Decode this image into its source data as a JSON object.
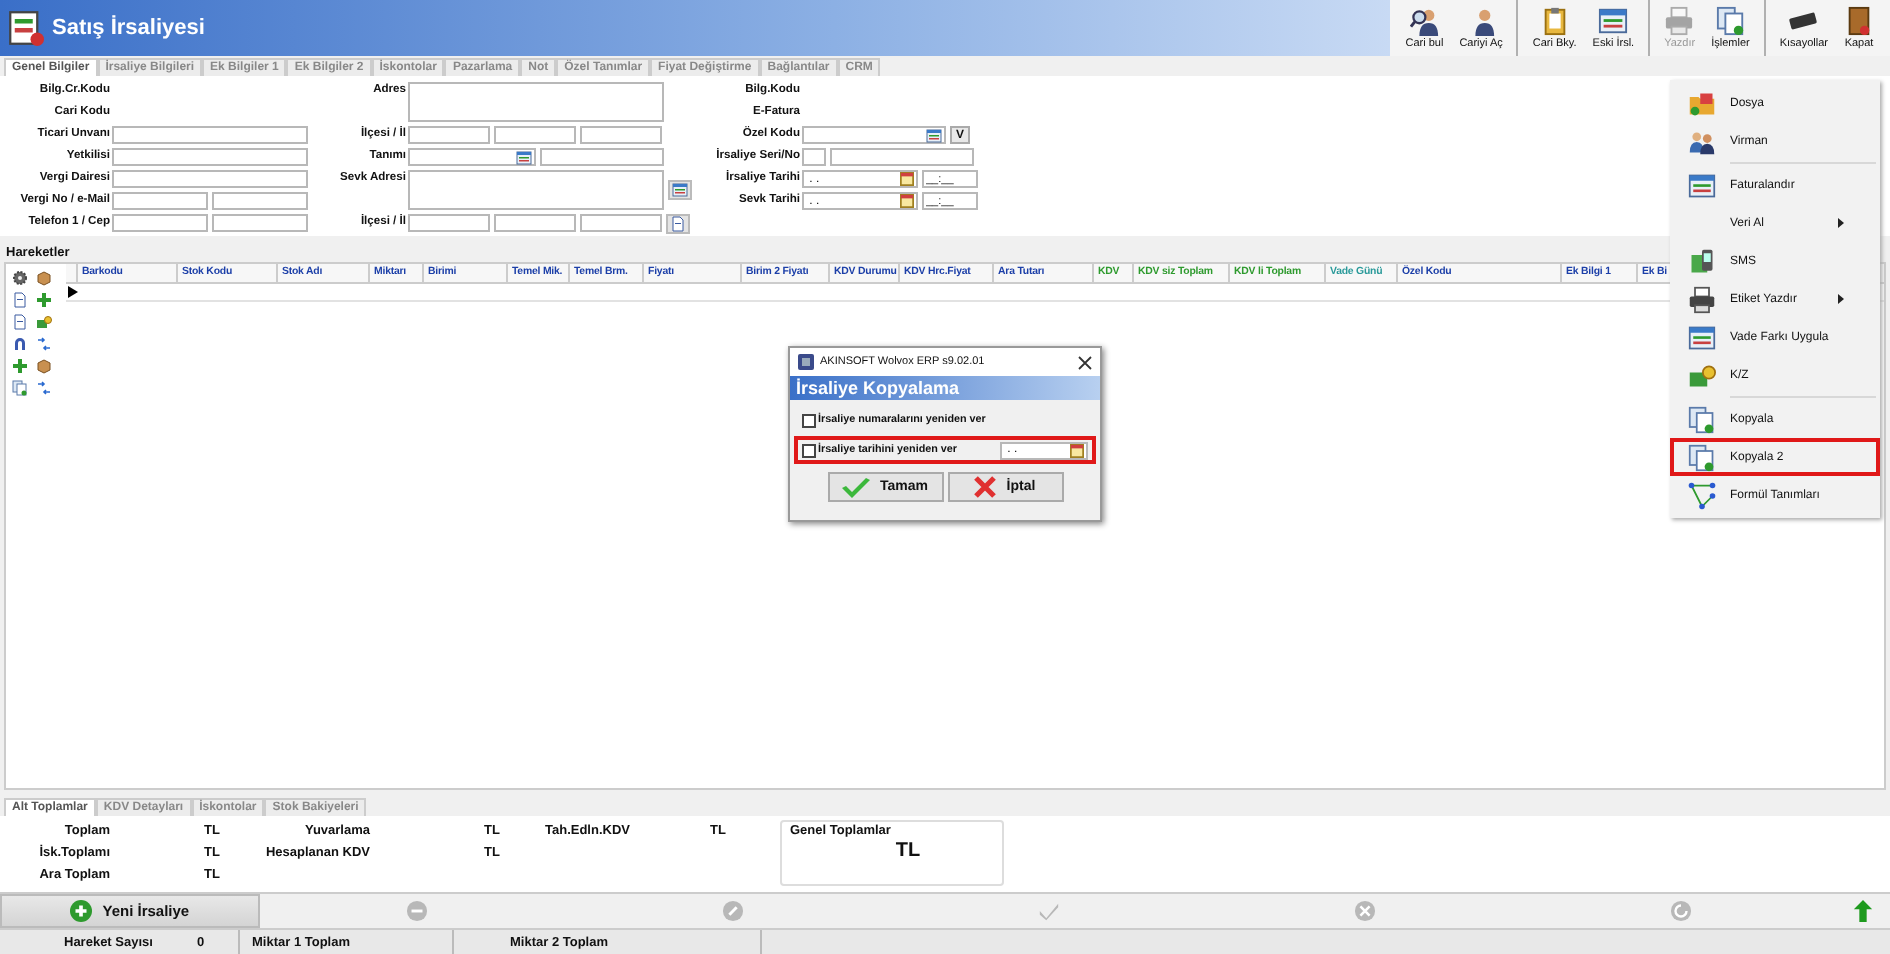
{
  "window": {
    "title": "Satış İrsaliyesi"
  },
  "toolbar": [
    {
      "label": "Cari bul",
      "disabled": false,
      "group_start": false
    },
    {
      "label": "Cariyi Aç",
      "disabled": false,
      "group_start": false
    },
    {
      "label": "Cari Bky.",
      "disabled": false,
      "group_start": true
    },
    {
      "label": "Eski İrsl.",
      "disabled": false,
      "group_start": false
    },
    {
      "label": "Yazdır",
      "disabled": true,
      "group_start": true
    },
    {
      "label": "İşlemler",
      "disabled": false,
      "group_start": false
    },
    {
      "label": "Kısayollar",
      "disabled": false,
      "group_start": true
    },
    {
      "label": "Kapat",
      "disabled": false,
      "group_start": false
    }
  ],
  "tabs": [
    {
      "label": "Genel Bilgiler",
      "selected": true
    },
    {
      "label": "İrsaliye Bilgileri",
      "selected": false
    },
    {
      "label": "Ek Bilgiler 1",
      "selected": false
    },
    {
      "label": "Ek Bilgiler 2",
      "selected": false
    },
    {
      "label": "İskontolar",
      "selected": false
    },
    {
      "label": "Pazarlama",
      "selected": false
    },
    {
      "label": "Not",
      "selected": false
    },
    {
      "label": "Özel Tanımlar",
      "selected": false
    },
    {
      "label": "Fiyat Değiştirme",
      "selected": false
    },
    {
      "label": "Bağlantılar",
      "selected": false
    },
    {
      "label": "CRM",
      "selected": false
    }
  ],
  "form": {
    "columns": [
      {
        "fields": [
          {
            "label": "Bilg.Cr.Kodu",
            "kind": "none"
          },
          {
            "label": "Cari Kodu",
            "kind": "none"
          },
          {
            "label": "Ticari Unvanı",
            "kind": "text"
          },
          {
            "label": "Yetkilisi",
            "kind": "text"
          },
          {
            "label": "Vergi Dairesi",
            "kind": "text"
          },
          {
            "label": "Vergi No / e-Mail",
            "kind": "double"
          },
          {
            "label": "Telefon 1 / Cep",
            "kind": "double"
          }
        ]
      },
      {
        "fields": [
          {
            "label": "Adres",
            "kind": "memo",
            "side_button": false
          },
          {
            "label": "İlçesi / İl",
            "kind": "triple",
            "side_button": false
          },
          {
            "label": "Tanımı",
            "kind": "lookup",
            "side_button": false
          },
          {
            "label": "Sevk Adresi",
            "kind": "memo",
            "side_button": true
          },
          {
            "label": "İlçesi / İl",
            "kind": "triple",
            "side_button": true
          }
        ]
      },
      {
        "fields": [
          {
            "label": "Bilg.Kodu",
            "kind": "none"
          },
          {
            "label": "E-Fatura",
            "kind": "none"
          },
          {
            "label": "Özel Kodu",
            "kind": "code",
            "button": "V"
          },
          {
            "label": "İrsaliye Seri/No",
            "kind": "serial"
          },
          {
            "label": "İrsaliye Tarihi",
            "kind": "date",
            "value": " . .",
            "time": "__:__"
          },
          {
            "label": "Sevk Tarihi",
            "kind": "date",
            "value": " . .",
            "time": "__:__"
          }
        ]
      }
    ]
  },
  "grid": {
    "title": "Hareketler",
    "columns": [
      {
        "label": "Barkodu",
        "color": "#1c3fa8"
      },
      {
        "label": "Stok Kodu",
        "color": "#1c3fa8"
      },
      {
        "label": "Stok Adı",
        "color": "#1c3fa8"
      },
      {
        "label": "Miktarı",
        "color": "#1c3fa8"
      },
      {
        "label": "Birimi",
        "color": "#1c3fa8"
      },
      {
        "label": "Temel Mik.",
        "color": "#1c3fa8"
      },
      {
        "label": "Temel Brm.",
        "color": "#1c3fa8"
      },
      {
        "label": "Fiyatı",
        "color": "#1c3fa8"
      },
      {
        "label": "Birim 2 Fiyatı",
        "color": "#1c3fa8"
      },
      {
        "label": "KDV Durumu",
        "color": "#1c3fa8"
      },
      {
        "label": "KDV Hrc.Fiyat",
        "color": "#1c3fa8"
      },
      {
        "label": "Ara Tutarı",
        "color": "#1c3fa8"
      },
      {
        "label": "KDV",
        "color": "#2e9a2e"
      },
      {
        "label": "KDV siz Toplam",
        "color": "#2e9a2e"
      },
      {
        "label": "KDV li Toplam",
        "color": "#2e9a2e"
      },
      {
        "label": "Vade Günü",
        "color": "#2a9a9a"
      },
      {
        "label": "Özel Kodu",
        "color": "#1c3fa8"
      },
      {
        "label": "Ek Bilgi 1",
        "color": "#1c3fa8"
      },
      {
        "label": "Ek Bi",
        "color": "#1c3fa8"
      }
    ]
  },
  "context_menu": [
    {
      "label": "Dosya",
      "has_icon": true,
      "submenu": false,
      "separator_before": false,
      "highlighted": false
    },
    {
      "label": "Virman",
      "has_icon": true,
      "submenu": false,
      "separator_before": false,
      "highlighted": false
    },
    {
      "label": "Faturalandır",
      "has_icon": true,
      "submenu": false,
      "separator_before": true,
      "highlighted": false
    },
    {
      "label": "Veri Al",
      "has_icon": false,
      "submenu": true,
      "separator_before": false,
      "highlighted": false
    },
    {
      "label": "SMS",
      "has_icon": true,
      "submenu": false,
      "separator_before": false,
      "highlighted": false
    },
    {
      "label": "Etiket Yazdır",
      "has_icon": true,
      "submenu": true,
      "separator_before": false,
      "highlighted": false
    },
    {
      "label": "Vade Farkı Uygula",
      "has_icon": true,
      "submenu": false,
      "separator_before": false,
      "highlighted": false
    },
    {
      "label": "K/Z",
      "has_icon": true,
      "submenu": false,
      "separator_before": false,
      "highlighted": false
    },
    {
      "label": "Kopyala",
      "has_icon": true,
      "submenu": false,
      "separator_before": true,
      "highlighted": false
    },
    {
      "label": "Kopyala 2",
      "has_icon": true,
      "submenu": false,
      "separator_before": false,
      "highlighted": true
    },
    {
      "label": "Formül Tanımları",
      "has_icon": true,
      "submenu": false,
      "separator_before": false,
      "highlighted": false
    }
  ],
  "dialog": {
    "title": "AKINSOFT Wolvox ERP s9.02.01",
    "heading": "İrsaliye Kopyalama",
    "options": [
      {
        "label": "İrsaliye numaralarını yeniden ver",
        "checked": false,
        "kind": "checkbox",
        "highlighted": false
      },
      {
        "label": "İrsaliye tarihini yeniden ver",
        "checked": false,
        "kind": "date",
        "value": " . .",
        "highlighted": true
      }
    ],
    "buttons": [
      {
        "label": "Tamam",
        "kind": "ok"
      },
      {
        "label": "İptal",
        "kind": "cancel"
      }
    ]
  },
  "bottom_tabs": [
    {
      "label": "Alt Toplamlar",
      "selected": true
    },
    {
      "label": "KDV Detayları",
      "selected": false
    },
    {
      "label": "İskontolar",
      "selected": false
    },
    {
      "label": "Stok Bakiyeleri",
      "selected": false
    }
  ],
  "totals": [
    {
      "rows": [
        {
          "label": "Toplam",
          "value": "TL"
        },
        {
          "label": "İsk.Toplamı",
          "value": "TL"
        },
        {
          "label": "Ara Toplam",
          "value": "TL"
        }
      ]
    },
    {
      "rows": [
        {
          "label": "Yuvarlama",
          "value": "TL"
        },
        {
          "label": "Hesaplanan KDV",
          "value": "TL"
        }
      ]
    },
    {
      "rows": [
        {
          "label": "Tah.Edln.KDV",
          "value": "TL"
        }
      ]
    }
  ],
  "grand_total": {
    "title": "Genel Toplamlar",
    "value": "TL"
  },
  "actions": {
    "new_button": "Yeni İrsaliye",
    "icons": [
      {
        "kind": "minus",
        "disabled": true
      },
      {
        "kind": "edit",
        "disabled": true
      },
      {
        "kind": "check",
        "disabled": true
      },
      {
        "kind": "close",
        "disabled": true
      },
      {
        "kind": "refresh",
        "disabled": true
      },
      {
        "kind": "up",
        "disabled": false
      }
    ]
  },
  "status_bar": [
    {
      "label": "Hareket Sayısı",
      "value": "0"
    },
    {
      "label": "Miktar 1 Toplam"
    },
    {
      "label": "Miktar 2 Toplam"
    }
  ]
}
